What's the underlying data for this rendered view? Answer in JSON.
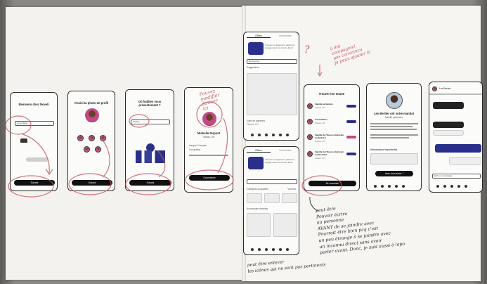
{
  "screens": {
    "s1": {
      "title": "Bienvenu chez Noveli",
      "input_value": "Anne Marie",
      "button_label": "Suivant"
    },
    "s2": {
      "title": "Choisi ta photo de profil",
      "button_label": "Suivant"
    },
    "s3": {
      "title": "Où habites vous présentement ?",
      "input_value": "Ottawa",
      "button_label": "Suivant"
    },
    "s4": {
      "name": "Michelle Dupont",
      "subtitle": "Ottawa, ON",
      "row1": "Langue: Français",
      "row2": "Occupation",
      "button_label": "Commencer"
    },
    "s5": {
      "tab_active": "Offres",
      "tab_other": "Demandes",
      "banner_title": "Trouvez un logement, partez en voyage avec une bonne âme !",
      "search_placeholder": "Rechercher",
      "section": "Suggestions",
      "list_title": "Votre de logement",
      "list_sub": "Ottawa, ON"
    },
    "s6": {
      "tab_active": "Offres",
      "tab_other": "Demandes",
      "banner_title": "Trouvez un logement, partez en voyage avec une bonne âme !",
      "section1": "Catégories populaires",
      "section2": "Nouveautés récentes",
      "more": "Voir tout"
    },
    "s7": {
      "title": "Trouver ton Imant!",
      "rows": [
        {
          "name": "Famille partenaire",
          "sub": "Ottawa, ON"
        },
        {
          "name": "Colocataires",
          "sub": "Ottawa, ON"
        },
        {
          "name": "Famille de l'Ouest-Américain du Sud-Est",
          "sub": "Ottawa, ON"
        },
        {
          "name": "Famille de l'Ouest-Américain du Nord-Est",
          "sub": "Ottawa, ON"
        }
      ],
      "button_label": "Se connecter"
    },
    "s8": {
      "title": "Les Bertier ont votre mandat",
      "subtitle": "Famille partenaire",
      "section": "Informations importantes",
      "button_label": "Avez-vous aimer ?"
    },
    "s9": {
      "header": "Les Bertier",
      "input_placeholder": "Écrire un message"
    }
  },
  "annotations": {
    "red_top": "à été\ncompagnie!\npas convaincu\nje peux ajouter la",
    "red_side": "Pouvez\nmodifier\ndonner\nici",
    "black_bottom": "peut être\nPouvoir écrire\nau personne\nAVANT de se joindre avec\nPourrait être bien pcq c'est\nun peu étrange à se joindre avec\nun inconnu direct sans avoir\nparler avant. Donc, je suis aussi à lapo",
    "black_left": "peut être enlever\nles icônes qui ne sont pas pertinents"
  }
}
